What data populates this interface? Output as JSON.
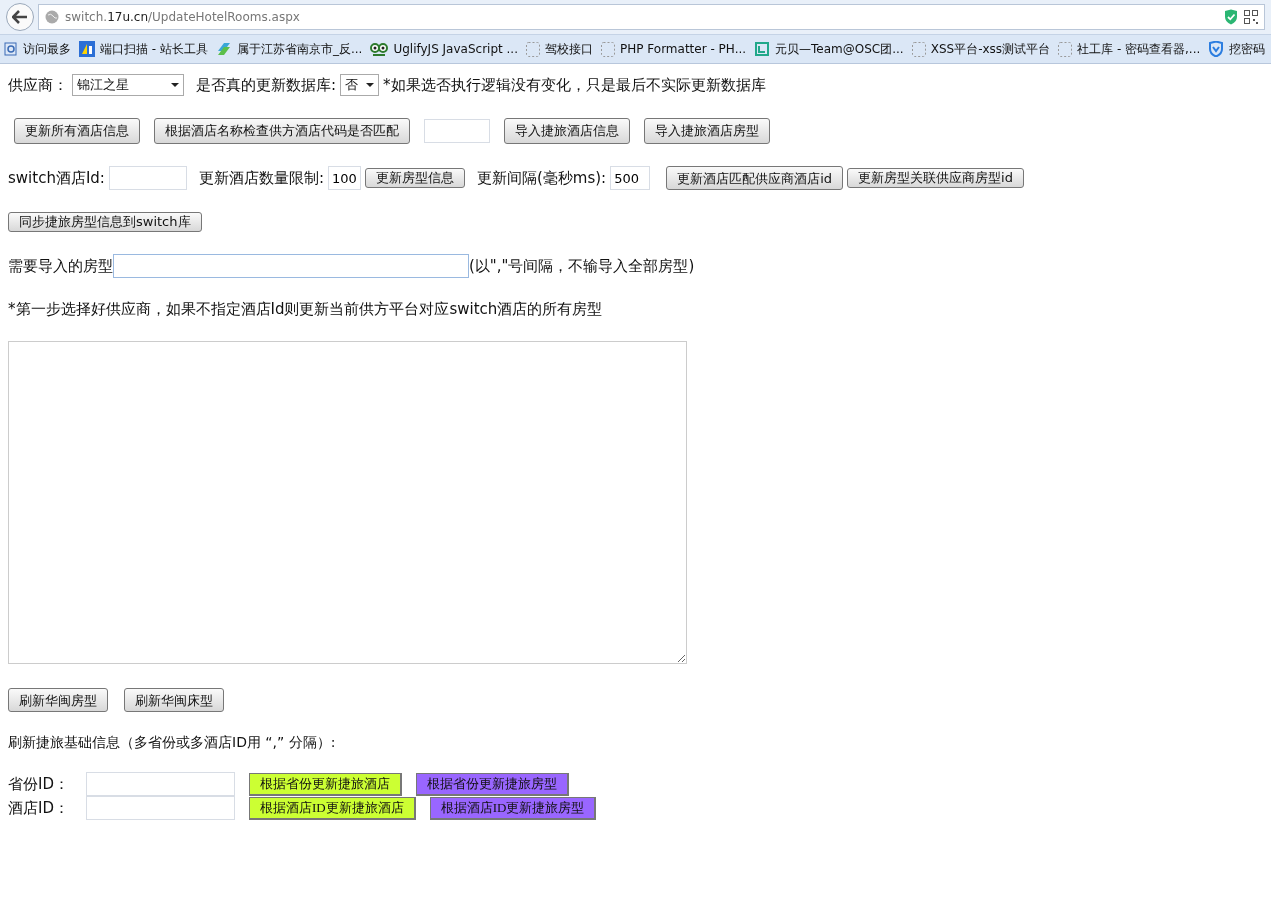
{
  "browser": {
    "url_host": "switch.",
    "url_domain": "17u.cn",
    "url_path": "/UpdateHotelRooms.aspx"
  },
  "bookmarks": [
    {
      "label": "访问最多",
      "kind": "page"
    },
    {
      "label": "端口扫描 - 站长工具",
      "kind": "chart"
    },
    {
      "label": "属于江苏省南京市_反...",
      "kind": "arrows"
    },
    {
      "label": "UglifyJS JavaScript ...",
      "kind": "owl"
    },
    {
      "label": "驾校接口",
      "kind": "blank"
    },
    {
      "label": "PHP Formatter - PH...",
      "kind": "blank"
    },
    {
      "label": "元贝—Team@OSC团...",
      "kind": "bracket"
    },
    {
      "label": "XSS平台-xss测试平台",
      "kind": "blank"
    },
    {
      "label": "社工库 - 密码查看器,...",
      "kind": "blank"
    },
    {
      "label": "挖密码",
      "kind": "shield"
    }
  ],
  "row1": {
    "supplier_label": "供应商：",
    "supplier_value": "锦江之星",
    "real_update_label": "是否真的更新数据库:",
    "real_update_value": "否",
    "note": "*如果选否执行逻辑没有变化，只是最后不实际更新数据库"
  },
  "row2": {
    "buttons_before": [
      "更新所有酒店信息",
      "根据酒店名称检查供方酒店代码是否匹配"
    ],
    "buttons_after": [
      "导入捷旅酒店信息",
      "导入捷旅酒店房型"
    ]
  },
  "row3": {
    "hotel_id_label": "switch酒店Id:",
    "limit_label": "更新酒店数量限制:",
    "limit_value": "100",
    "update_rooms_button": "更新房型信息",
    "interval_label": "更新间隔(毫秒ms):",
    "interval_value": "500",
    "match_button": "更新酒店匹配供应商酒店id",
    "room_link_button": "更新房型关联供应商房型id"
  },
  "sync_button": "同步捷旅房型信息到switch库",
  "room_types": {
    "label": "需要导入的房型",
    "hint": "(以\",\"号间隔，不输导入全部房型)"
  },
  "step_note": "*第一步选择好供应商，如果不指定酒店Id则更新当前供方平台对应switch酒店的所有房型",
  "refresh_buttons": [
    "刷新华闽房型",
    "刷新华闽床型"
  ],
  "base_info_title": "刷新捷旅基础信息（多省份或多酒店ID用 “,” 分隔）:",
  "id_rows": [
    {
      "label": "省份ID：",
      "buttons": [
        {
          "label": "根据省份更新捷旅酒店",
          "color": "#ccff33"
        },
        {
          "label": "根据省份更新捷旅房型",
          "color": "#9966ff"
        }
      ]
    },
    {
      "label": "酒店ID：",
      "buttons": [
        {
          "label": "根据酒店ID更新捷旅酒店",
          "color": "#ccff33"
        },
        {
          "label": "根据酒店ID更新捷旅房型",
          "color": "#9966ff"
        }
      ]
    }
  ]
}
